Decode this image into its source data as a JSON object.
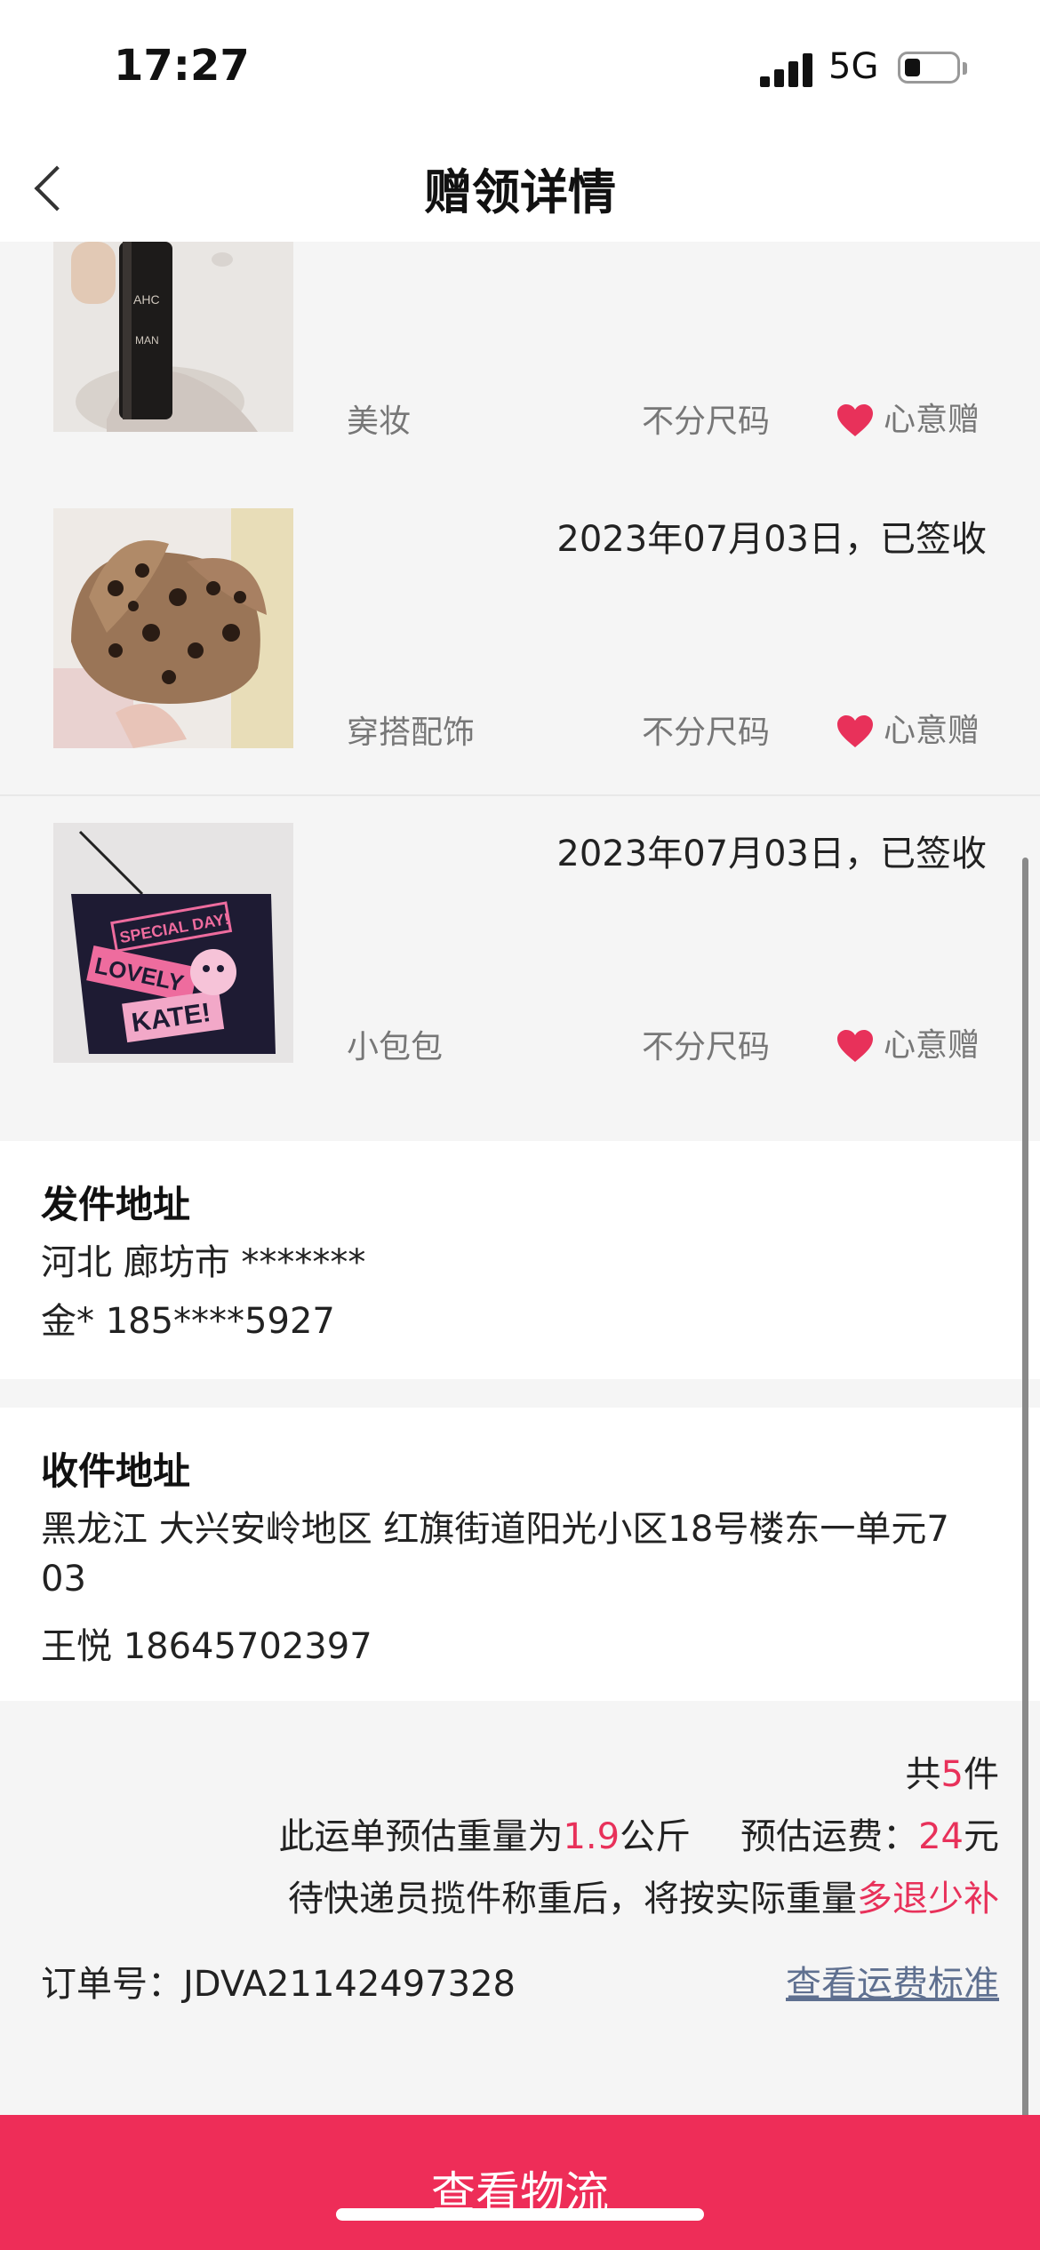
{
  "status_bar": {
    "time": "17:27",
    "network": "5G"
  },
  "nav": {
    "title": "赠领详情"
  },
  "items": [
    {
      "date": "",
      "category": "美妆",
      "size": "不分尺码",
      "gift": "心意赠"
    },
    {
      "date": "2023年07月03日，已签收",
      "category": "穿搭配饰",
      "size": "不分尺码",
      "gift": "心意赠"
    },
    {
      "date": "2023年07月03日，已签收",
      "category": "小包包",
      "size": "不分尺码",
      "gift": "心意赠"
    }
  ],
  "thumb_texts": {
    "bag_line1": "SPECIAL DAY!",
    "bag_line2": "LOVELY",
    "bag_line3": "KATE!",
    "bottle_brand": "AHC",
    "bottle_line": "MAN"
  },
  "sender": {
    "title": "发件地址",
    "region": "河北 廊坊市 *******",
    "contact": "金* 185****5927"
  },
  "receiver": {
    "title": "收件地址",
    "address_line1": "黑龙江 大兴安岭地区 红旗街道阳光小区18号楼东一单元7",
    "address_line2": "03",
    "contact": "王悦 18645702397"
  },
  "summary": {
    "count_prefix": "共",
    "count": "5",
    "count_suffix": "件",
    "weight_prefix": "此运单预估重量为",
    "weight": "1.9",
    "weight_unit": "公斤",
    "fee_prefix": "预估运费：",
    "fee": "24",
    "fee_unit": "元",
    "note_prefix": "待快递员揽件称重后，将按实际重量",
    "note_highlight": "多退少补",
    "order_label": "订单号：JDVA21142497328",
    "fee_link": "查看运费标准"
  },
  "bottom": {
    "button_label": "查看物流"
  },
  "colors": {
    "accent": "#ee2d58",
    "highlight": "#e8315a",
    "link": "#5f7090"
  }
}
